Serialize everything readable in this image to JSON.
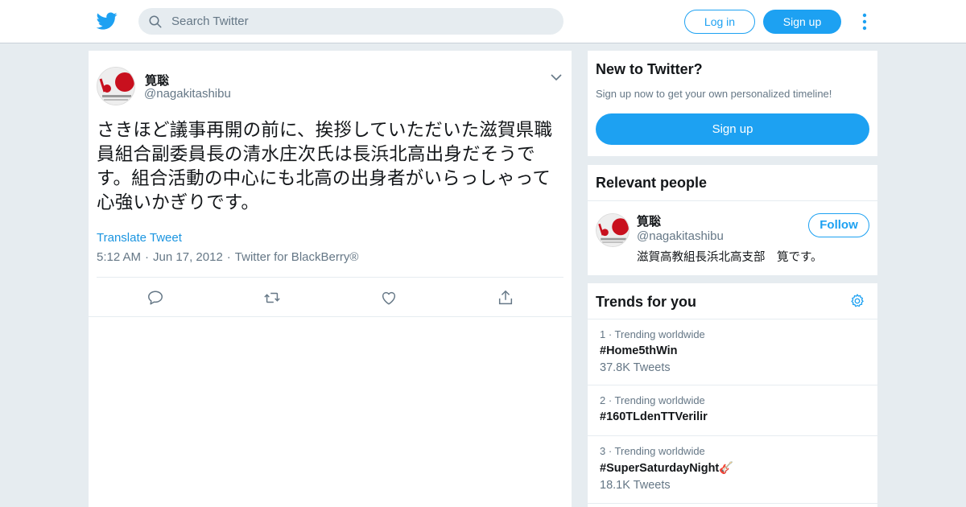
{
  "header": {
    "search_placeholder": "Search Twitter",
    "login_label": "Log in",
    "signup_label": "Sign up"
  },
  "tweet": {
    "author_name": "筧聡",
    "author_handle": "@nagakitashibu",
    "text": "さきほど議事再開の前に、挨拶していただいた滋賀県職員組合副委員長の清水庄次氏は長浜北高出身だそうです。組合活動の中心にも北高の出身者がいらっしゃって心強いかぎりです。",
    "translate_label": "Translate Tweet",
    "time": "5:12 AM",
    "date": "Jun 17, 2012",
    "source": "Twitter for BlackBerry®"
  },
  "new_to_twitter": {
    "title": "New to Twitter?",
    "subtitle": "Sign up now to get your own personalized timeline!",
    "signup_label": "Sign up"
  },
  "relevant_people": {
    "title": "Relevant people",
    "name": "筧聡",
    "handle": "@nagakitashibu",
    "bio": "滋賀高教組長浜北高支部　筧です。",
    "follow_label": "Follow"
  },
  "trends": {
    "title": "Trends for you",
    "items": [
      {
        "rank": "1 · Trending worldwide",
        "tag": "#Home5thWin",
        "count": "37.8K Tweets"
      },
      {
        "rank": "2 · Trending worldwide",
        "tag": "#160TLdenTTVerilir",
        "count": ""
      },
      {
        "rank": "3 · Trending worldwide",
        "tag": "#SuperSaturdayNight🎸",
        "count": "18.1K Tweets"
      }
    ]
  },
  "colors": {
    "accent": "#1da1f2",
    "background": "#e6ecf0",
    "secondary_text": "#657786"
  }
}
